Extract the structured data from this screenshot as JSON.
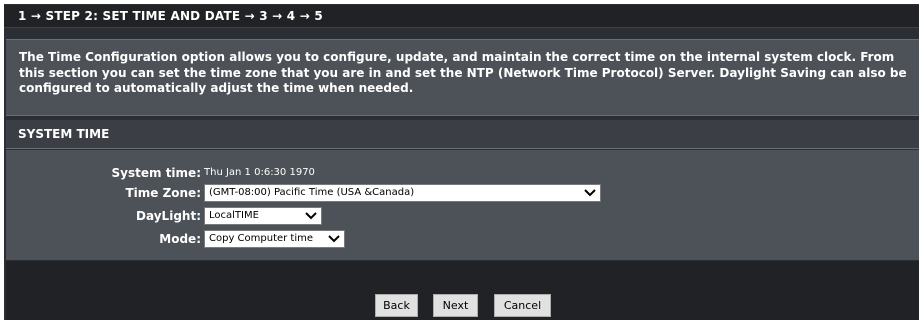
{
  "step_bar": {
    "text": "1 → STEP 2: SET TIME AND DATE → 3 → 4 → 5"
  },
  "info": {
    "text": "The Time Configuration option allows you to configure, update, and maintain the correct time on the internal system clock. From this section you can set the time zone that you are in and set the NTP (Network Time Protocol) Server. Daylight Saving can also be configured to automatically adjust the time when needed."
  },
  "section": {
    "title": "SYSTEM TIME"
  },
  "form": {
    "system_time": {
      "label": "System time:",
      "value": "Thu Jan 1 0:6:30 1970"
    },
    "time_zone": {
      "label": "Time Zone:",
      "selected": "(GMT-08:00) Pacific Time (USA &Canada)",
      "icon": "chevron-down-icon"
    },
    "daylight": {
      "label": "DayLight:",
      "selected": "LocalTIME",
      "icon": "chevron-down-icon"
    },
    "mode": {
      "label": "Mode:",
      "selected": "Copy Computer time",
      "icon": "chevron-down-icon"
    }
  },
  "buttons": {
    "back": "Back",
    "next": "Next",
    "cancel": "Cancel"
  },
  "colors": {
    "panel_bg": "#2b2e33",
    "step_bar_bg": "#202226",
    "info_bg": "#4d5158",
    "section_bg": "#3b3e44",
    "footer_bg": "#202226",
    "button_bg": "#e1e1e1"
  }
}
